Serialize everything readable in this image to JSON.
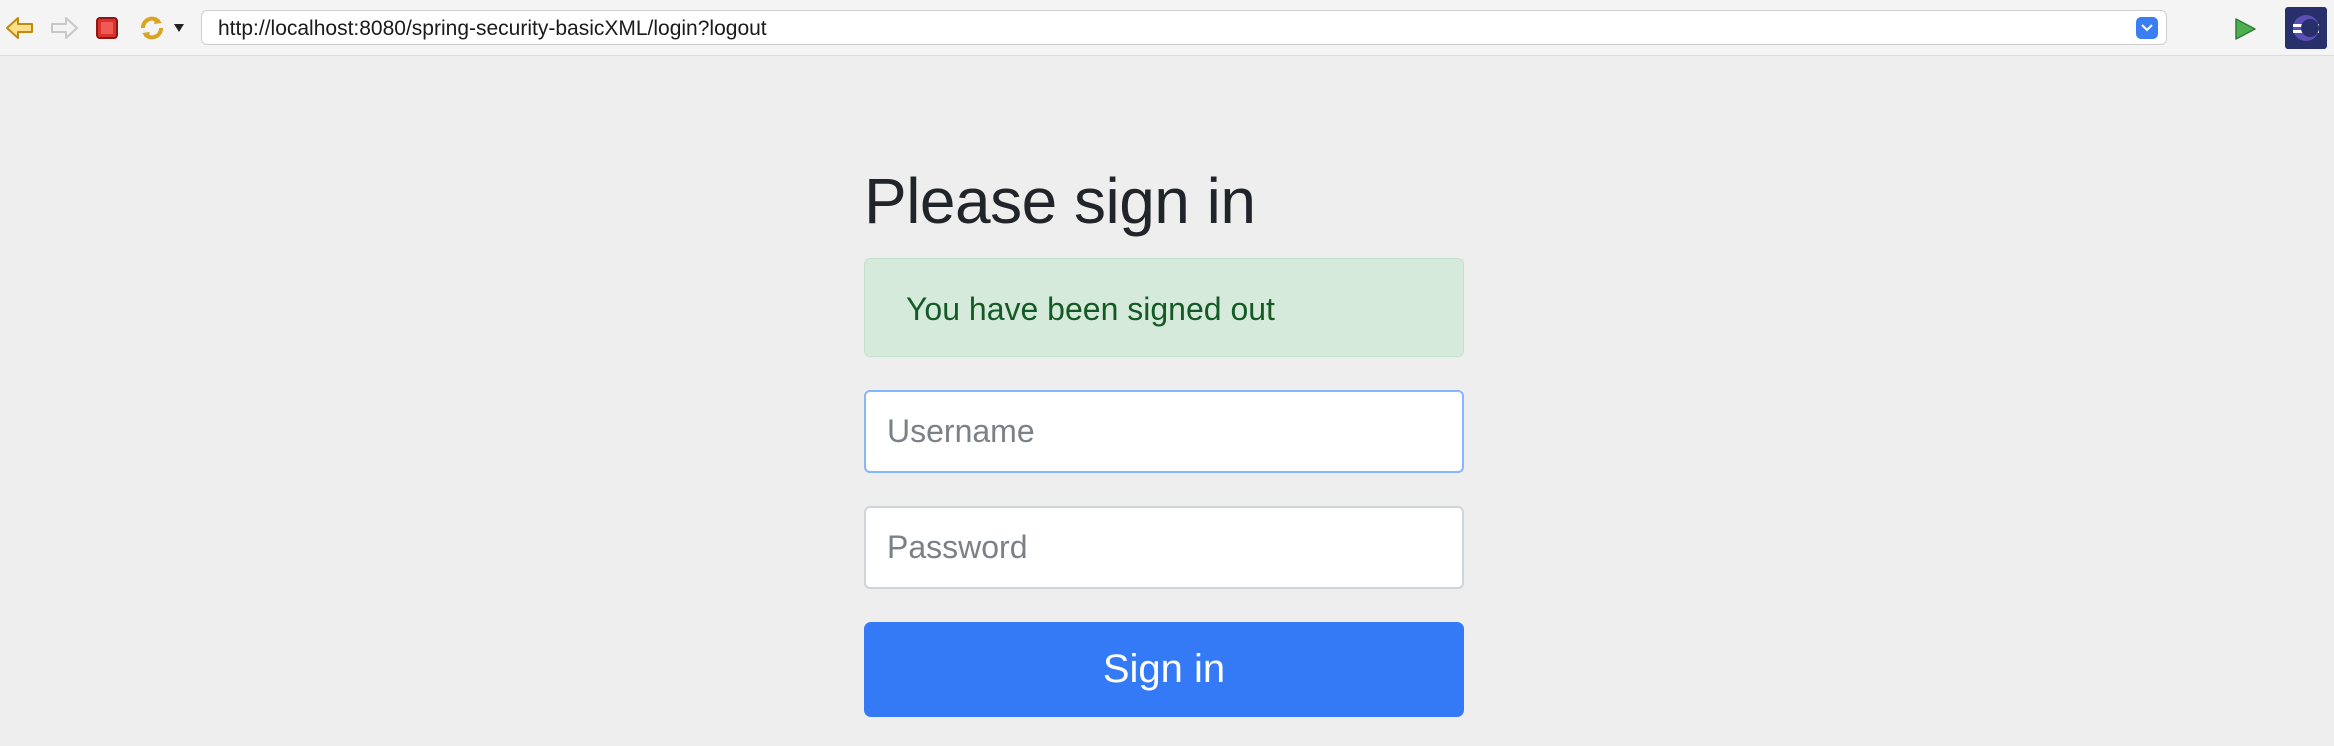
{
  "browser": {
    "url": "http://localhost:8080/spring-security-basicXML/login?logout",
    "icons": {
      "back": "back-arrow-icon",
      "forward": "forward-arrow-icon",
      "stop": "stop-icon",
      "refresh": "refresh-icon",
      "refresh_menu": "dropdown-triangle-icon",
      "url_dropdown": "chevron-down-icon",
      "go": "go-play-icon",
      "app": "eclipse-logo-icon"
    }
  },
  "page": {
    "heading": "Please sign in",
    "alert": "You have been signed out",
    "username_placeholder": "Username",
    "password_placeholder": "Password",
    "submit_label": "Sign in"
  },
  "colors": {
    "background": "#eeeeee",
    "alert_bg": "#d6eadc",
    "alert_text": "#145a25",
    "primary_button": "#3479f6",
    "focus_border": "#86b7fe"
  }
}
